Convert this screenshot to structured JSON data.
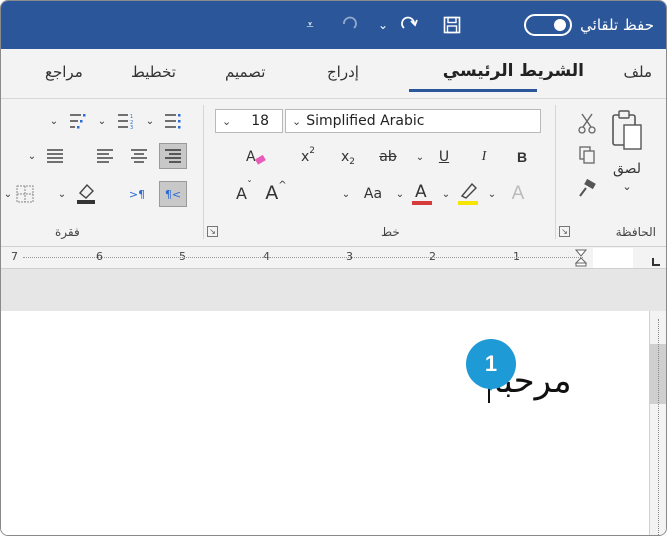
{
  "titlebar": {
    "autosave_label": "حفظ تلقائي",
    "icons": [
      "save-icon",
      "undo-icon",
      "redo-icon",
      "customize-dropdown-icon"
    ]
  },
  "tabs": [
    {
      "label": "ملف",
      "active": false
    },
    {
      "label": "الشريط الرئيسي",
      "active": true
    },
    {
      "label": "إدراج",
      "active": false
    },
    {
      "label": "تصميم",
      "active": false
    },
    {
      "label": "تخطيط",
      "active": false
    },
    {
      "label": "مراجع",
      "active": false
    }
  ],
  "ribbon": {
    "clipboard": {
      "label": "الحافظة",
      "paste_label": "لصق"
    },
    "font": {
      "label": "خط",
      "font_name": "Simplified Arabic",
      "font_size": "18",
      "change_case": "Aa",
      "bold": "B",
      "italic": "I",
      "underline": "U",
      "strike": "ab"
    },
    "paragraph": {
      "label": "فقرة"
    }
  },
  "ruler": {
    "numbers": [
      "7",
      "6",
      "5",
      "4",
      "3",
      "2",
      "1"
    ]
  },
  "document": {
    "text": "مرحبا"
  },
  "callout": {
    "number": "1",
    "color": "#1e9ad6"
  },
  "colors": {
    "titlebar": "#2b579a",
    "font_color": "#d83b3b",
    "highlight": "#f5e500"
  }
}
